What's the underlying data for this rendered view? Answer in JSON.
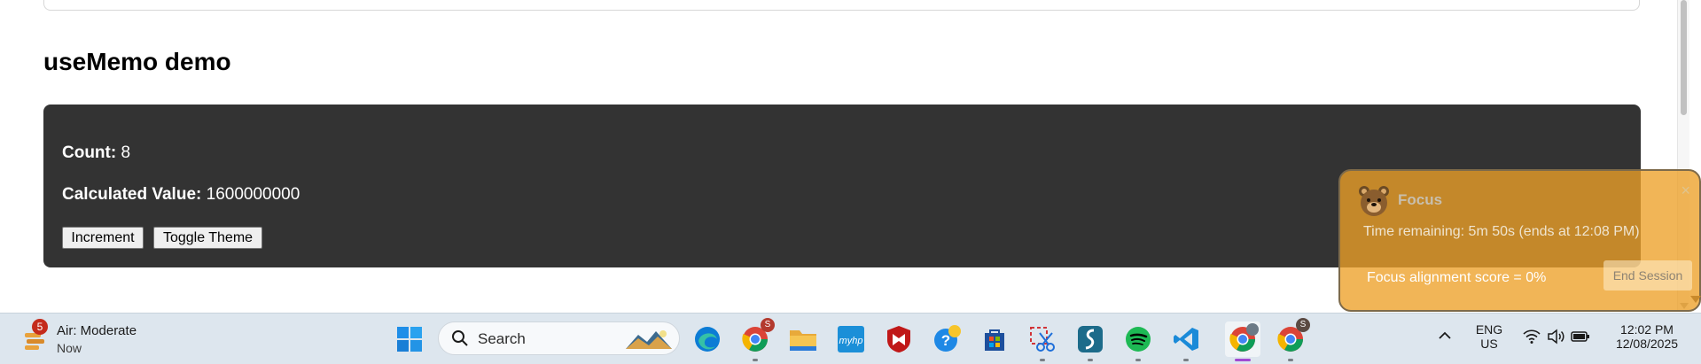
{
  "page": {
    "section_title": "useMemo demo",
    "count_label": "Count:",
    "count_value": "8",
    "calc_label": "Calculated Value:",
    "calc_value": "1600000000",
    "increment_label": "Increment",
    "toggle_label": "Toggle Theme"
  },
  "focus": {
    "title": "Focus",
    "close_glyph": "×",
    "time_remaining": "Time remaining: 5m 50s (ends at 12:08 PM)",
    "alignment": "Focus alignment score = 0%",
    "end_label": "End Session"
  },
  "taskbar": {
    "weather_title": "Air: Moderate",
    "weather_sub": "Now",
    "weather_badge": "5",
    "search_placeholder": "Search",
    "lang": "ENG",
    "region": "US",
    "time": "12:02 PM",
    "date": "12/08/2025",
    "profile_badge_1": "S",
    "profile_badge_2": "S",
    "icons": [
      "windows-start-icon",
      "search-icon",
      "edge-icon",
      "chrome-icon",
      "file-explorer-icon",
      "myhp-icon",
      "mcafee-icon",
      "help-icon",
      "microsoft-store-icon",
      "snipping-tool-icon",
      "surfshark-icon",
      "spotify-icon",
      "vscode-icon",
      "chrome-icon",
      "chrome-icon"
    ]
  },
  "colors": {
    "card_bg": "#333333",
    "focus_overlay": "#eda028",
    "taskbar_bg": "#dde6ee",
    "active_indicator": "#a04bd2"
  }
}
